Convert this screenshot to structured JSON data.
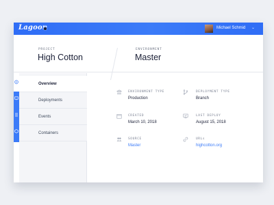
{
  "topbar": {
    "logo": "Lagoon",
    "user_name": "Michael Schmid",
    "chevron": "⌄"
  },
  "header": {
    "project_label": "PROJECT",
    "project_value": "High Cotton",
    "environment_label": "ENVIRONMENT",
    "environment_value": "Master"
  },
  "sidebar": {
    "items": [
      {
        "label": "Overview",
        "icon": "info-icon"
      },
      {
        "label": "Deployments",
        "icon": "monitor-icon"
      },
      {
        "label": "Events",
        "icon": "list-icon"
      },
      {
        "label": "Containers",
        "icon": "cubes-icon"
      }
    ]
  },
  "details": {
    "environment_type_label": "ENVIRONMENT TYPE",
    "environment_type_value": "Production",
    "deployment_type_label": "DEPLOYMENT TYPE",
    "deployment_type_value": "Branch",
    "created_label": "CREATED",
    "created_value": "March 10, 2018",
    "last_deploy_label": "LAST DEPLOY",
    "last_deploy_value": "August 15, 2018",
    "source_label": "SOURCE",
    "source_value": "Master",
    "urls_label": "URLs",
    "urls_value": "highcotton.org"
  },
  "colors": {
    "accent": "#3b7bf8",
    "text": "#1a1f36",
    "background": "#eef0f4"
  }
}
